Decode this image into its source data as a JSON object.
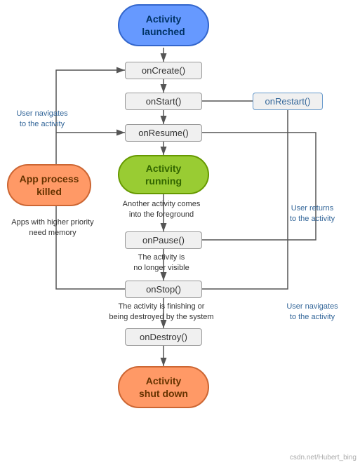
{
  "nodes": {
    "activity_launched": {
      "label": "Activity\nlaunched"
    },
    "on_create": {
      "label": "onCreate()"
    },
    "on_start": {
      "label": "onStart()"
    },
    "on_restart": {
      "label": "onRestart()"
    },
    "on_resume": {
      "label": "onResume()"
    },
    "activity_running": {
      "label": "Activity\nrunning"
    },
    "on_pause": {
      "label": "onPause()"
    },
    "on_stop": {
      "label": "onStop()"
    },
    "on_destroy": {
      "label": "onDestroy()"
    },
    "activity_shutdown": {
      "label": "Activity\nshut down"
    },
    "app_process_killed": {
      "label": "App process\nkilled"
    }
  },
  "labels": {
    "user_navigates_to": "User navigates\nto the activity",
    "another_activity": "Another activity comes\ninto the foreground",
    "user_returns": "User returns\nto the activity",
    "no_longer_visible": "The activity is\nno longer visible",
    "user_navigates_to2": "User navigates\nto the activity",
    "finishing_or_destroyed": "The activity is finishing or\nbeing destroyed by the system",
    "apps_higher_priority": "Apps with higher priority\nneed memory"
  },
  "watermark": "csdn.net/Hubert_bing"
}
